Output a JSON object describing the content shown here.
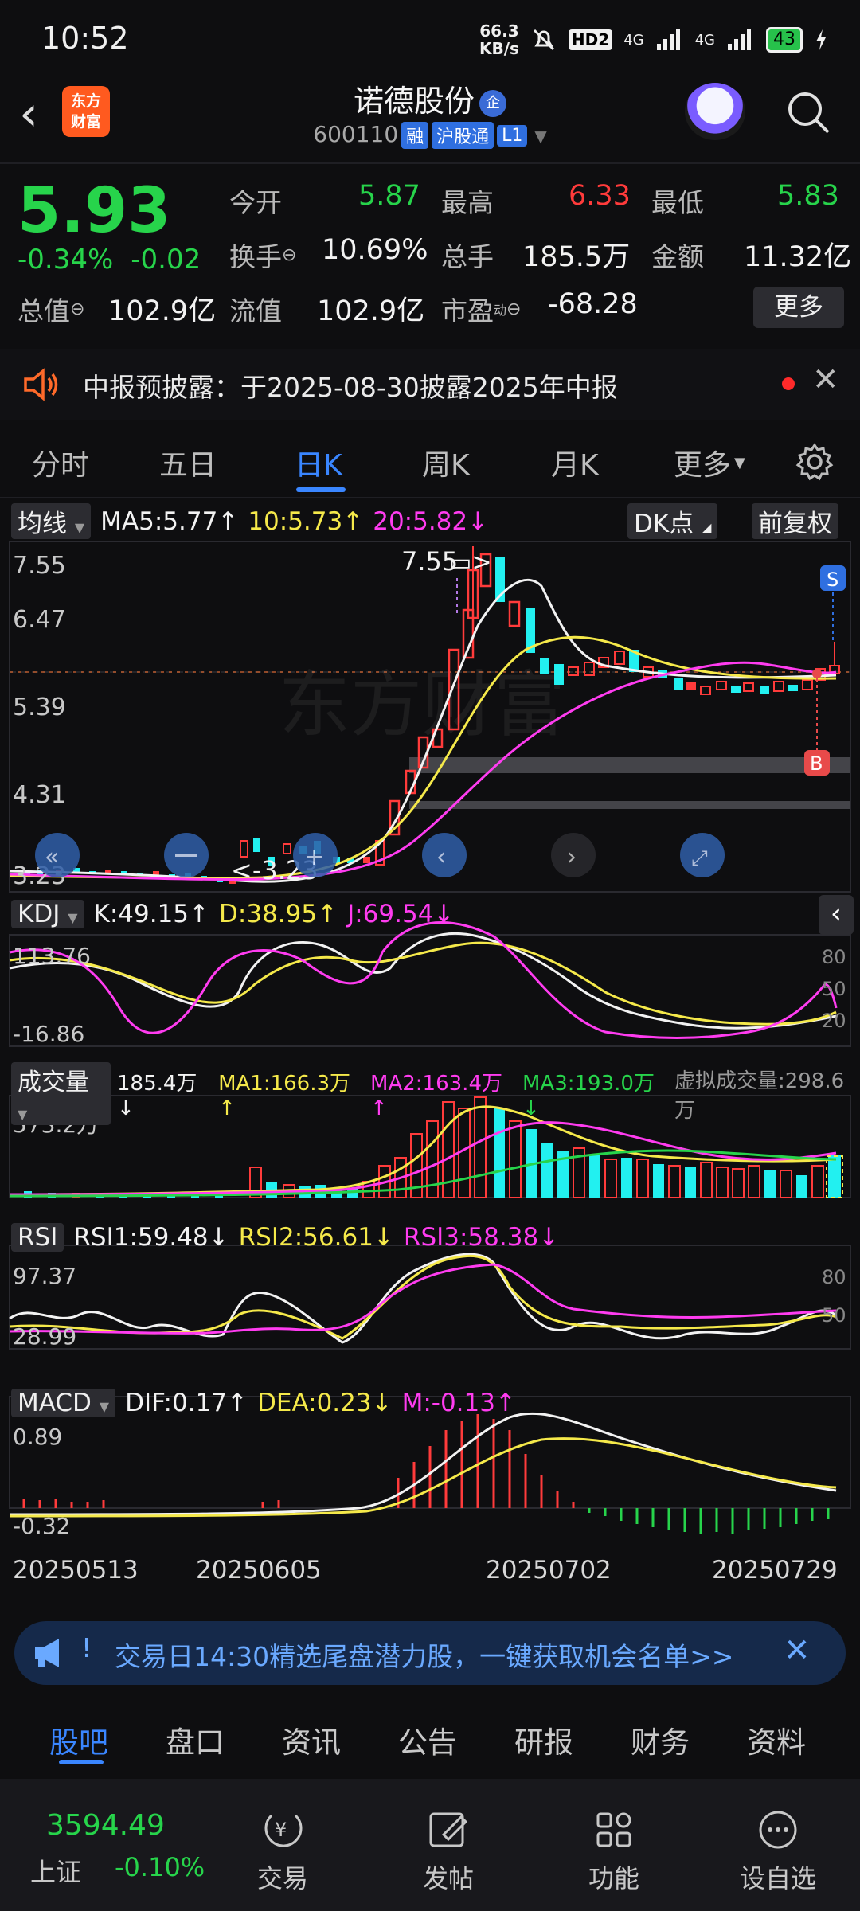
{
  "status": {
    "time": "10:52",
    "speed": "66.3",
    "speed_unit": "KB/s",
    "hd": "HD2",
    "net1": "4G",
    "net2": "4G",
    "battery": "43"
  },
  "header": {
    "logo_line1": "东方",
    "logo_line2": "财富",
    "stock_name": "诺德股份",
    "badge": "企",
    "code": "600110",
    "tags": [
      "融",
      "沪股通",
      "L1"
    ]
  },
  "quote": {
    "price": "5.93",
    "change_pct": "-0.34%",
    "change": "-0.02",
    "open_label": "今开",
    "open": "5.87",
    "high_label": "最高",
    "high": "6.33",
    "low_label": "最低",
    "low": "5.83",
    "turnover_label": "换手",
    "turnover": "10.69%",
    "volume_label": "总手",
    "volume": "185.5万",
    "amount_label": "金额",
    "amount": "11.32亿",
    "mktcap_label": "总值",
    "mktcap": "102.9亿",
    "float_label": "流值",
    "float": "102.9亿",
    "pe_label": "市盈",
    "pe_sup": "动",
    "pe": "-68.28",
    "more": "更多"
  },
  "notice": {
    "text": "中报预披露：于2025-08-30披露2025年中报"
  },
  "tabs": [
    "分时",
    "五日",
    "日K",
    "周K",
    "月K",
    "更多"
  ],
  "active_tab": "日K",
  "chart": {
    "ma_label": "均线",
    "ma5": "MA5:5.77",
    "ma10": "10:5.73",
    "ma20": "20:5.82",
    "arrow_up": "↑",
    "arrow_down": "↓",
    "dk": "DK点",
    "fuquan": "前复权",
    "price_ticks": [
      "7.55",
      "6.47",
      "5.39",
      "4.31",
      "3.23"
    ],
    "max_label": "7.55",
    "min_label": "3.23",
    "sell_mark": "S",
    "buy_mark": "B",
    "kdj": {
      "label": "KDJ",
      "k": "K:49.15",
      "d": "D:38.95",
      "j": "J:69.54",
      "top": "113.76",
      "bottom": "-16.86",
      "lv80": "80",
      "lv50": "50",
      "lv20": "20"
    },
    "vol": {
      "label": "成交量",
      "v": "185.4万",
      "ma1": "MA1:166.3万",
      "ma2": "MA2:163.4万",
      "ma3": "MA3:193.0万",
      "virtual": "虚拟成交量:298.6万",
      "top": "573.2万"
    },
    "rsi": {
      "label": "RSI",
      "r1": "RSI1:59.48",
      "r2": "RSI2:56.61",
      "r3": "RSI3:58.38",
      "top": "97.37",
      "bottom": "28.99",
      "lv80": "80",
      "lv50": "50"
    },
    "macd": {
      "label": "MACD",
      "dif": "DIF:0.17",
      "dea": "DEA:0.23",
      "m": "M:-0.13",
      "top": "0.89",
      "bottom": "-0.32"
    },
    "dates": [
      "20250513",
      "20250605",
      "20250702",
      "20250729"
    ]
  },
  "banner": {
    "text": "交易日14:30精选尾盘潜力股，一键获取机会名单>>"
  },
  "bottom_tabs": [
    "股吧",
    "盘口",
    "资讯",
    "公告",
    "研报",
    "财务",
    "资料"
  ],
  "bottom_nav": {
    "index_value": "3594.49",
    "index_name": "上证",
    "index_change": "-0.10%",
    "items": [
      "交易",
      "发帖",
      "功能",
      "设自选"
    ]
  },
  "colors": {
    "up": "#ff3b3b",
    "down": "#27d44b",
    "accent": "#3a86ff",
    "cyan": "#22f0f0",
    "yellow": "#f5e94a",
    "magenta": "#ff3cf0"
  }
}
